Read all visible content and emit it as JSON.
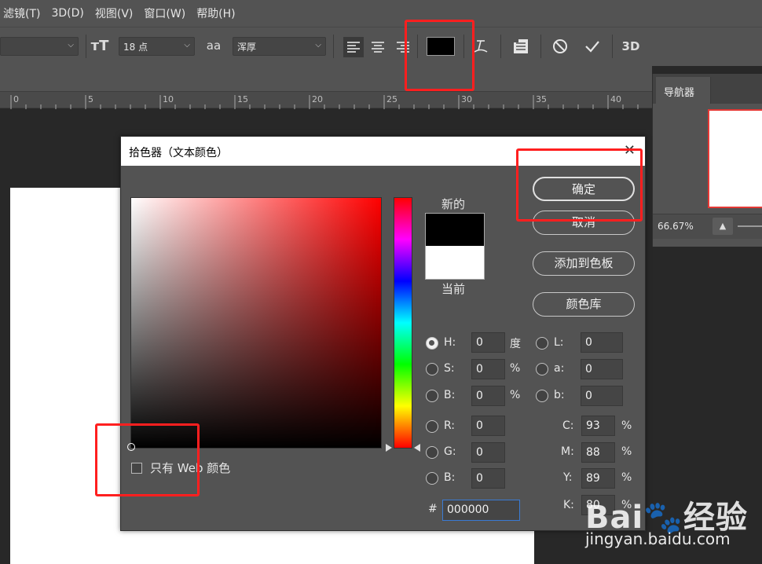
{
  "menu": [
    "滤镜(T)",
    "3D(D)",
    "视图(V)",
    "窗口(W)",
    "帮助(H)"
  ],
  "options": {
    "font_size": "18 点",
    "aa_icon": "aa",
    "aa_mode": "浑厚",
    "text_color_hex": "#000000",
    "threed_label": "3D"
  },
  "ruler": {
    "labels": [
      "0",
      "5",
      "10",
      "15",
      "20",
      "25",
      "30",
      "35",
      "40"
    ]
  },
  "navigator": {
    "tab": "导航器",
    "zoom": "66.67%"
  },
  "dialog": {
    "title": "拾色器（文本颜色）",
    "close": "✕",
    "new_label": "新的",
    "current_label": "当前",
    "buttons": {
      "ok": "确定",
      "cancel": "取消",
      "add_to_swatches": "添加到色板",
      "color_libraries": "颜色库"
    },
    "fields": {
      "H": {
        "label": "H:",
        "value": "0",
        "unit": "度"
      },
      "S": {
        "label": "S:",
        "value": "0",
        "unit": "%"
      },
      "B": {
        "label": "B:",
        "value": "0",
        "unit": "%"
      },
      "R": {
        "label": "R:",
        "value": "0"
      },
      "G": {
        "label": "G:",
        "value": "0"
      },
      "Bl": {
        "label": "B:",
        "value": "0"
      },
      "L": {
        "label": "L:",
        "value": "0"
      },
      "a": {
        "label": "a:",
        "value": "0"
      },
      "b": {
        "label": "b:",
        "value": "0"
      },
      "C": {
        "label": "C:",
        "value": "93",
        "unit": "%"
      },
      "M": {
        "label": "M:",
        "value": "88",
        "unit": "%"
      },
      "Y": {
        "label": "Y:",
        "value": "89",
        "unit": "%"
      },
      "K": {
        "label": "K:",
        "value": "80",
        "unit": "%"
      }
    },
    "hash": "#",
    "hex_value": "000000",
    "web_only_label": "只有 Web 颜色"
  },
  "watermark": {
    "logo": "Bai🐾经验",
    "url": "jingyan.baidu.com"
  },
  "colors": {
    "highlight": "#ff1f1f",
    "panel": "#535353"
  }
}
